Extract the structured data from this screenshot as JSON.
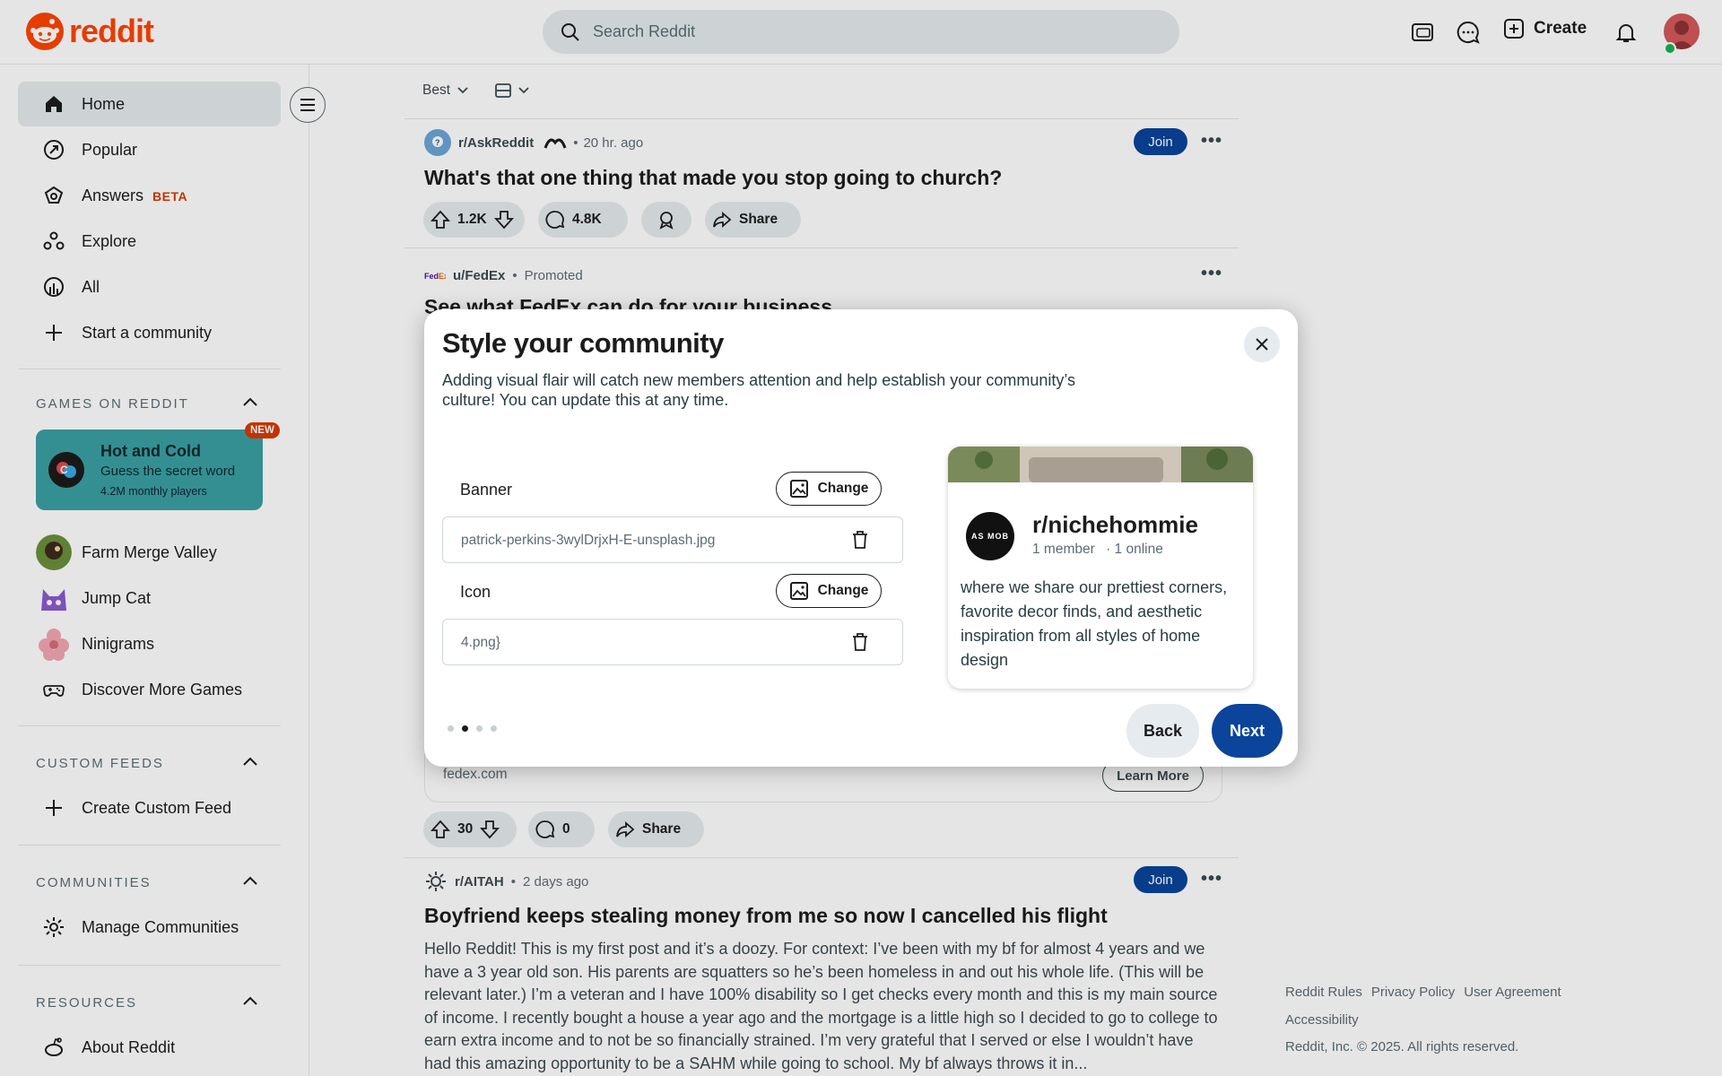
{
  "header": {
    "logo_text": "reddit",
    "search_placeholder": "Search Reddit",
    "create_label": "Create",
    "icons": [
      "advertise-icon",
      "chat-icon",
      "create-icon",
      "notifications-icon"
    ]
  },
  "sidebar": {
    "nav": [
      {
        "label": "Home",
        "icon": "home-icon",
        "active": true
      },
      {
        "label": "Popular",
        "icon": "popular-icon"
      },
      {
        "label": "Answers",
        "icon": "answers-icon",
        "badge": "BETA"
      },
      {
        "label": "Explore",
        "icon": "explore-icon"
      },
      {
        "label": "All",
        "icon": "all-icon"
      },
      {
        "label": "Start a community",
        "icon": "plus-icon"
      }
    ],
    "games_title": "GAMES ON REDDIT",
    "featured_game": {
      "title": "Hot and Cold",
      "subtitle": "Guess the secret word",
      "players": "4.2M monthly players",
      "badge": "NEW"
    },
    "games": [
      "Farm Merge Valley",
      "Jump Cat",
      "Ninigrams",
      "Discover More Games"
    ],
    "custom_feeds_title": "CUSTOM FEEDS",
    "create_custom_feed": "Create Custom Feed",
    "communities_title": "COMMUNITIES",
    "manage_communities": "Manage Communities",
    "resources_title": "RESOURCES",
    "about_reddit": "About Reddit"
  },
  "feed": {
    "sort_label": "Best",
    "posts": [
      {
        "subreddit": "r/AskReddit",
        "time": "20 hr. ago",
        "join": "Join",
        "title": "What's that one thing that made you stop going to church?",
        "votes": "1.2K",
        "comments": "4.8K",
        "share": "Share"
      },
      {
        "subreddit": "u/FedEx",
        "promoted": "Promoted",
        "title": "See what FedEx can do for your business",
        "domain": "fedex.com",
        "cta": "Learn More",
        "votes": "30",
        "comments": "0",
        "share": "Share"
      },
      {
        "subreddit": "r/AITAH",
        "time": "2 days ago",
        "join": "Join",
        "title": "Boyfriend keeps stealing money from me so now I cancelled his flight",
        "body": "Hello Reddit! This is my first post and it’s a doozy. For context: I’ve been with my bf for almost 4 years and we have a 3 year old son. His parents are squatters so he’s been homeless in and out his whole life. (This will be relevant later.) I’m a veteran and I have 100% disability so I get checks every month and this is my main source of income. I recently bought a house a year ago and the mortgage is a little high so I decided to go to college to earn extra income and to not be so financially strained. I’m very grateful that I served or else I wouldn’t have had this amazing opportunity to be a SAHM while going to school. My bf always throws it in..."
      }
    ]
  },
  "footer": {
    "links": [
      "Reddit Rules",
      "Privacy Policy",
      "User Agreement",
      "Accessibility"
    ],
    "copyright": "Reddit, Inc. © 2025. All rights reserved."
  },
  "modal": {
    "title": "Style your community",
    "description": "Adding visual flair will catch new members attention and help establish your community’s culture! You can update this at any time.",
    "banner_label": "Banner",
    "banner_file": "patrick-perkins-3wylDrjxH-E-unsplash.jpg",
    "icon_label": "Icon",
    "icon_file": "4.png}",
    "change_label": "Change",
    "preview": {
      "icon_text": "AS MOB",
      "name": "r/nichehommie",
      "members": "1 member",
      "online": "· 1 online",
      "description": "where we share our prettiest corners, favorite decor finds, and aesthetic inspiration from all styles of home design"
    },
    "steps_total": 4,
    "current_step": 2,
    "back_label": "Back",
    "next_label": "Next"
  },
  "colors": {
    "brand": "#ff4500",
    "primary": "#0a449b",
    "beta": "#d93a00"
  }
}
